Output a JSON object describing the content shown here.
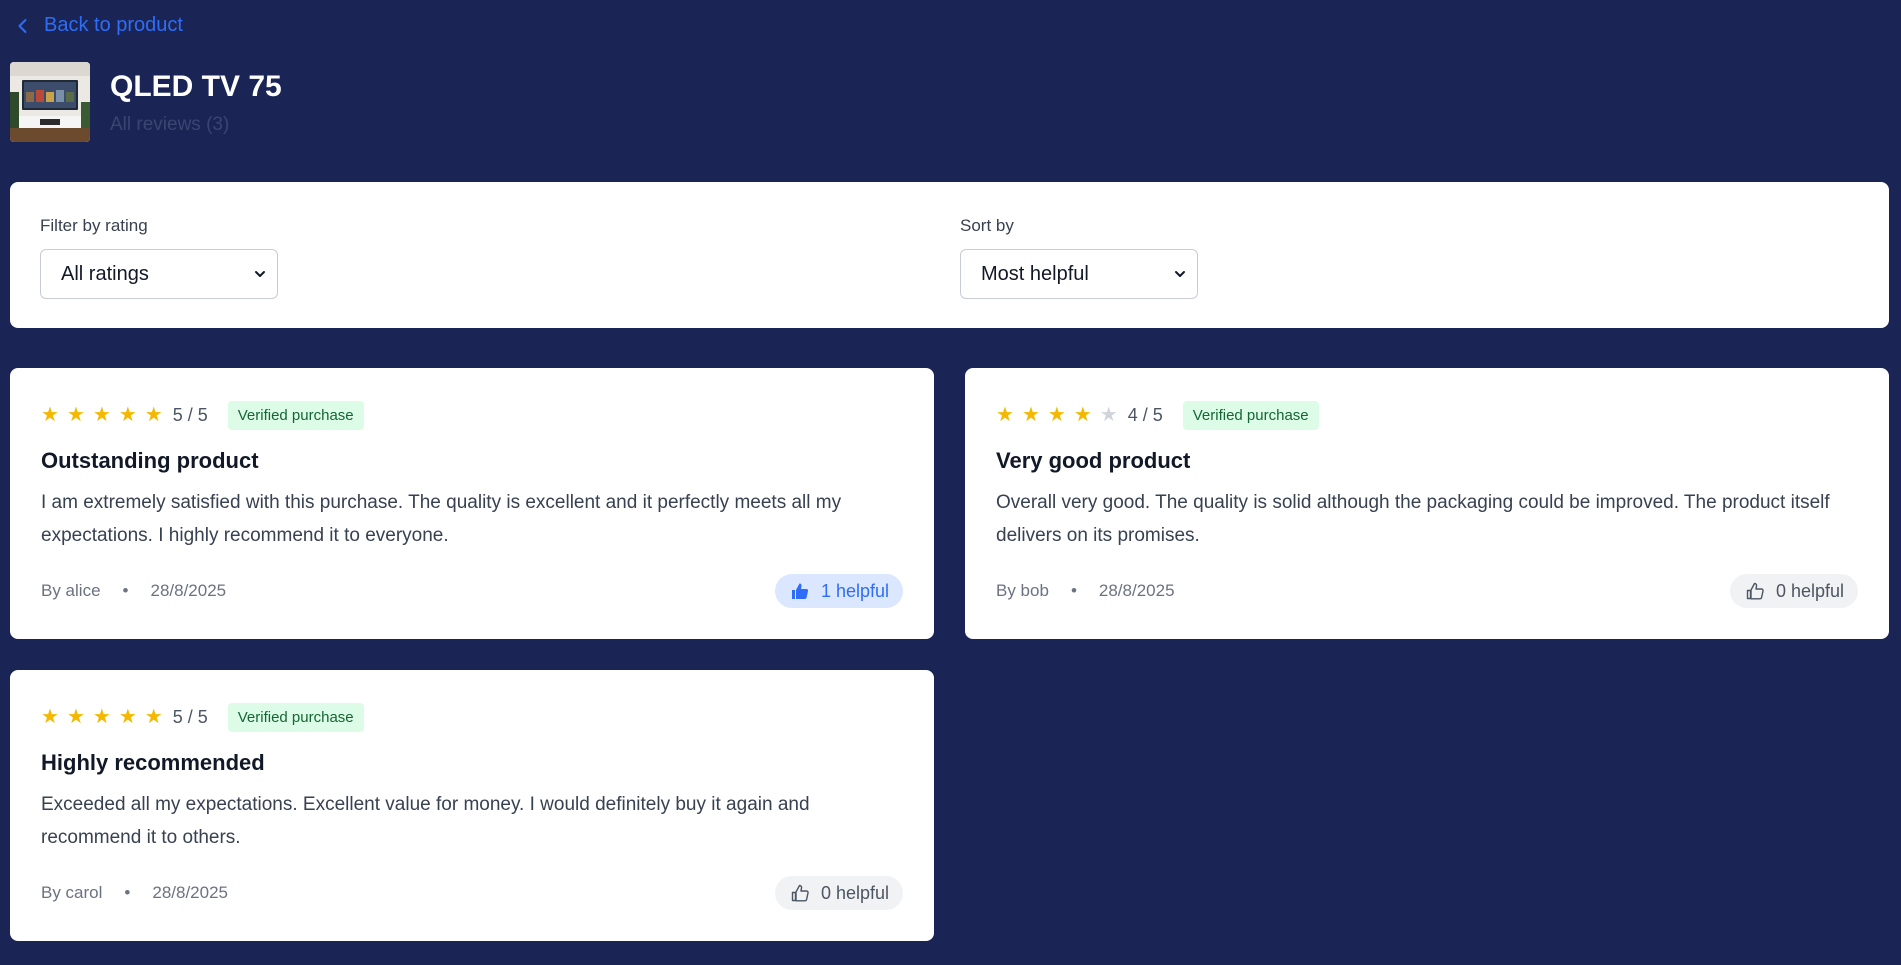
{
  "nav": {
    "back_label": "Back to product"
  },
  "product": {
    "title": "QLED TV 75",
    "subtitle": "All reviews (3)"
  },
  "filters": {
    "rating_label": "Filter by rating",
    "rating_value": "All ratings",
    "sort_label": "Sort by",
    "sort_value": "Most helpful"
  },
  "colors": {
    "background": "#1a2555",
    "accent": "#2f6df6",
    "star": "#f5b800",
    "verified_bg": "#dcfce7"
  },
  "reviews": [
    {
      "rating": 5,
      "rating_text": "5 / 5",
      "verified": "Verified purchase",
      "title": "Outstanding product",
      "body": "I am extremely satisfied with this purchase. The quality is excellent and it perfectly meets all my expectations. I highly recommend it to everyone.",
      "author": "By alice",
      "date": "28/8/2025",
      "helpful": "1 helpful",
      "helpful_active": true
    },
    {
      "rating": 4,
      "rating_text": "4 / 5",
      "verified": "Verified purchase",
      "title": "Very good product",
      "body": "Overall very good. The quality is solid although the packaging could be improved. The product itself delivers on its promises.",
      "author": "By bob",
      "date": "28/8/2025",
      "helpful": "0 helpful",
      "helpful_active": false
    },
    {
      "rating": 5,
      "rating_text": "5 / 5",
      "verified": "Verified purchase",
      "title": "Highly recommended",
      "body": "Exceeded all my expectations. Excellent value for money. I would definitely buy it again and recommend it to others.",
      "author": "By carol",
      "date": "28/8/2025",
      "helpful": "0 helpful",
      "helpful_active": false
    }
  ]
}
